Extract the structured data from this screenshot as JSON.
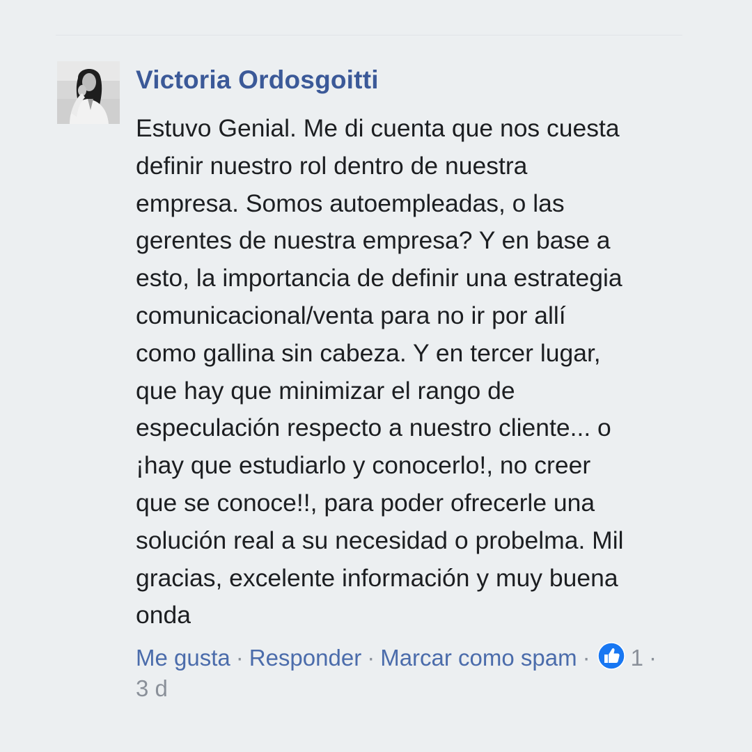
{
  "comment": {
    "author": "Victoria Ordosgoitti",
    "avatar_icon": "profile-photo",
    "text": "Estuvo Genial. Me di cuenta que nos cuesta\ndefinir nuestro rol dentro de nuestra\nempresa. Somos autoempleadas, o las\ngerentes de nuestra empresa? Y en base a\nesto, la importancia de definir una estrategia\ncomunicacional/venta para no ir por allí\ncomo gallina sin cabeza. Y en tercer lugar,\nque hay que minimizar el rango de\nespeculación respecto a nuestro cliente... o\n¡hay que estudiarlo y conocerlo!, no creer\nque se conoce!!, para poder ofrecerle una\nsolución real a su necesidad o probelma. Mil\ngracias, excelente información y muy buena\nonda",
    "actions": {
      "like_label": "Me gusta",
      "reply_label": "Responder",
      "spam_label": "Marcar como spam",
      "separator": "·",
      "reaction_icon": "thumbs-up-icon",
      "reaction_count": "1",
      "timestamp": "3 d"
    }
  },
  "colors": {
    "background": "#eceff1",
    "author": "#3b5998",
    "link": "#4b6cab",
    "muted": "#8a9099",
    "like_badge": "#1877f2"
  }
}
